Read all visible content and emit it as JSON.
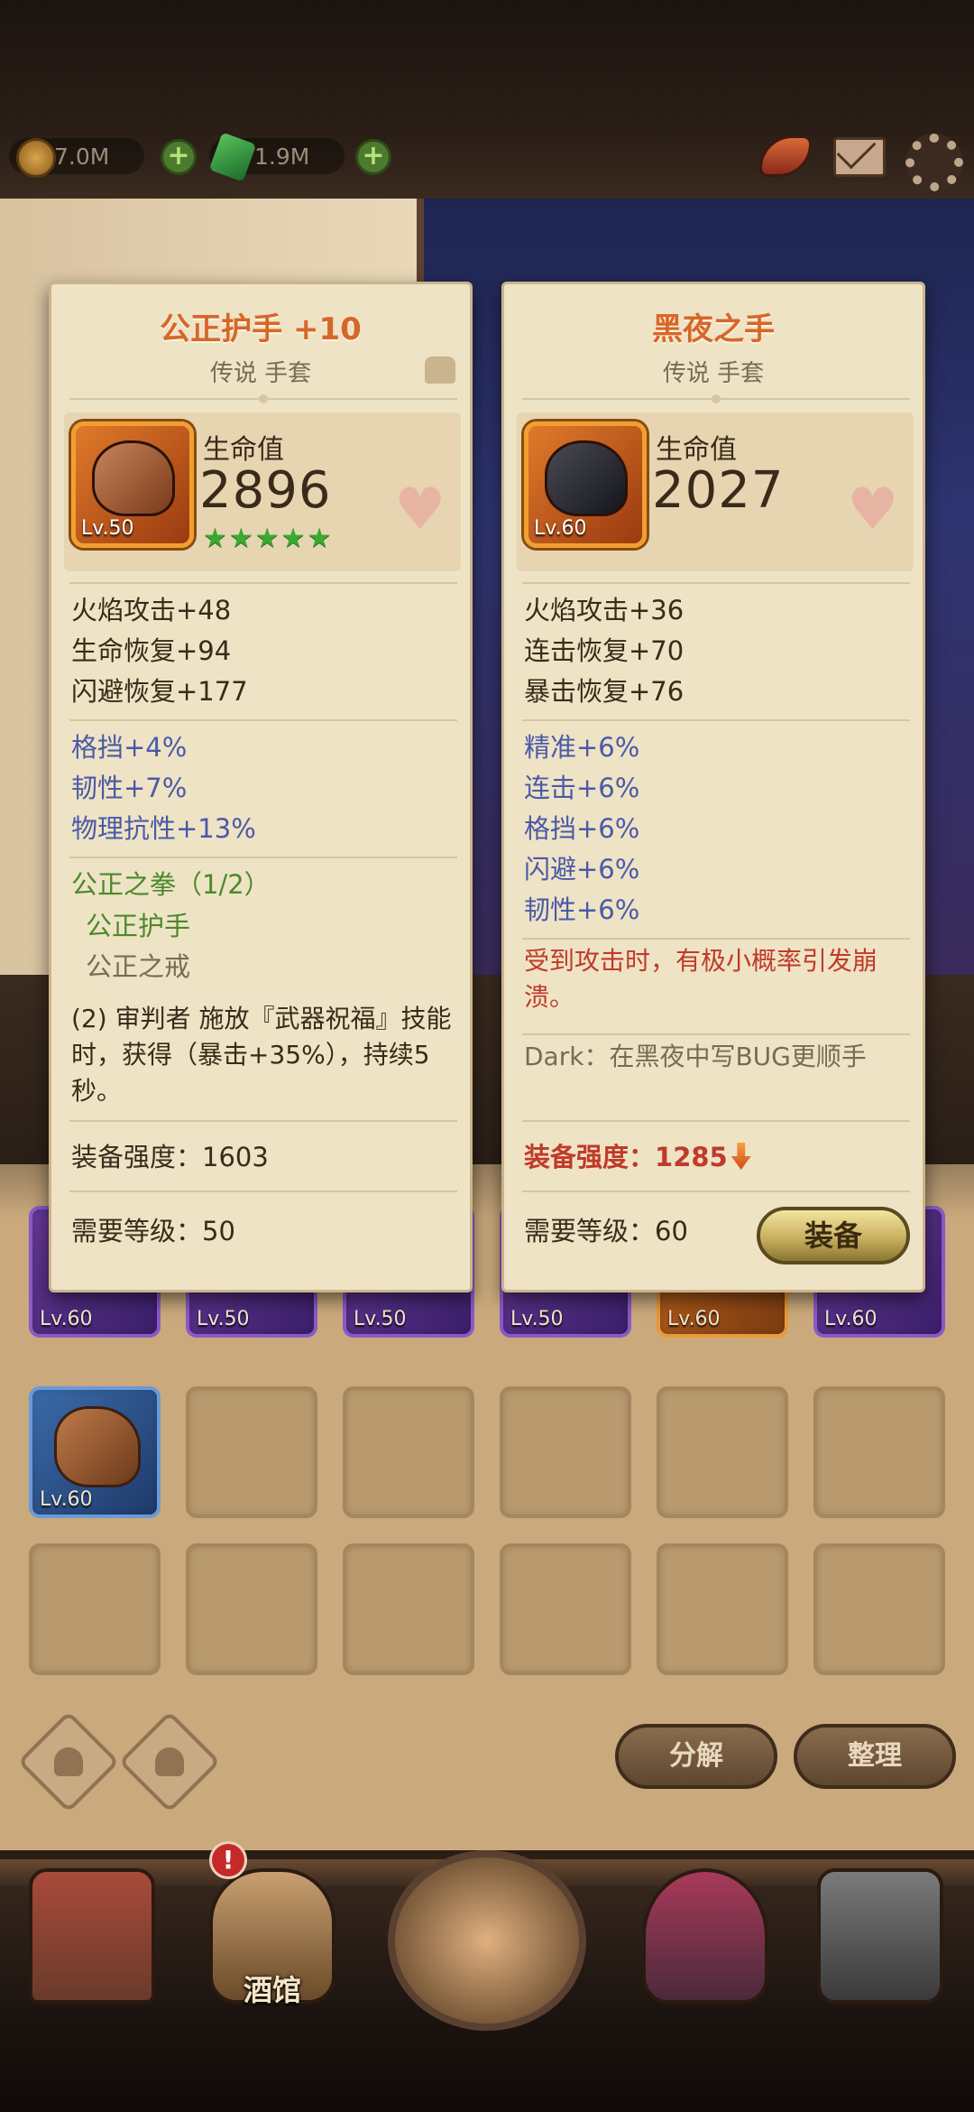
{
  "resources": {
    "gold": "7.0M",
    "gems": "1.9M"
  },
  "left_card": {
    "title": "公正护手 +10",
    "subtitle": "传说 手套",
    "level": "Lv.50",
    "hp_label": "生命值",
    "hp_value": "2896",
    "stars": "★★★★★",
    "base_stats": [
      "火焰攻击+48",
      "生命恢复+94",
      "闪避恢复+177"
    ],
    "bonus_stats": [
      "格挡+4%",
      "韧性+7%",
      "物理抗性+13%"
    ],
    "set_name": "公正之拳（1/2）",
    "set_items": [
      "公正护手",
      "公正之戒"
    ],
    "set_bonus": "(2) 审判者 施放『武器祝福』技能时，获得（暴击+35%），持续5秒。",
    "power_label": "装备强度：",
    "power_value": "1603",
    "req_label": "需要等级：",
    "req_value": "50"
  },
  "right_card": {
    "title": "黑夜之手",
    "subtitle": "传说 手套",
    "level": "Lv.60",
    "hp_label": "生命值",
    "hp_value": "2027",
    "base_stats": [
      "火焰攻击+36",
      "连击恢复+70",
      "暴击恢复+76"
    ],
    "bonus_stats": [
      "精准+6%",
      "连击+6%",
      "格挡+6%",
      "闪避+6%",
      "韧性+6%"
    ],
    "special": "受到攻击时，有极小概率引发崩溃。",
    "flavor": "Dark：在黑夜中写BUG更顺手",
    "power_label": "装备强度：",
    "power_value": "1285",
    "req_label": "需要等级：",
    "req_value": "60",
    "equip_label": "装备"
  },
  "inventory": {
    "row1_levels": [
      "Lv.60",
      "Lv.50",
      "Lv.50",
      "Lv.50",
      "Lv.60",
      "Lv.60"
    ],
    "row2_levels": [
      "Lv.60"
    ]
  },
  "actions": {
    "disassemble": "分解",
    "sort": "整理"
  },
  "nav": {
    "tavern": "酒馆",
    "alert": "!"
  },
  "colors": {
    "title_orange": "#d5672a",
    "stat_blue": "#4a5aa8",
    "set_green": "#4a8a2a",
    "special_red": "#c03a2a"
  }
}
